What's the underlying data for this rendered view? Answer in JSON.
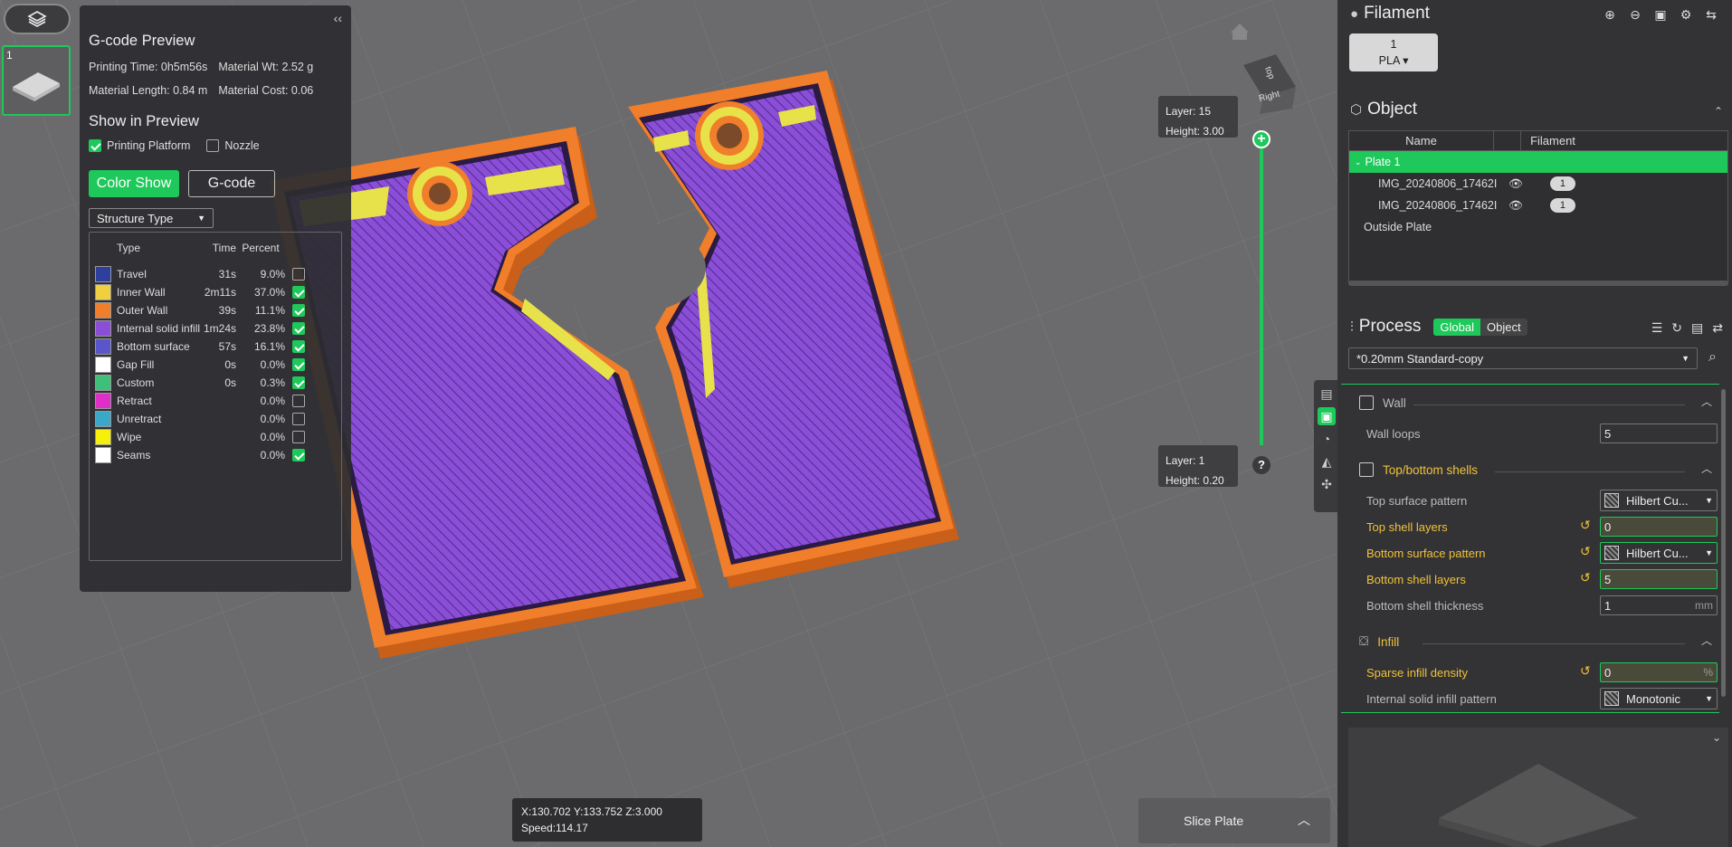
{
  "viewport": {
    "plate_thumb_number": "1",
    "nav_cube": {
      "top": "top",
      "right": "Right"
    },
    "layer_top": {
      "layer": "Layer: 15",
      "height": "Height: 3.00"
    },
    "layer_bottom": {
      "layer": "Layer: 1",
      "height": "Height: 0.20"
    },
    "slider_add": "+",
    "slider_help": "?",
    "coords": {
      "pos": "X:130.702  Y:133.752  Z:3.000",
      "speed": "Speed:114.17"
    },
    "slice_button": "Slice Plate",
    "colors": {
      "purple": "#8a4fd6",
      "orange": "#f07e2a",
      "yellow": "#e8e24a",
      "accent": "#1ec85a"
    }
  },
  "gcode_panel": {
    "collapse": "‹‹",
    "title": "G-code Preview",
    "printing_time": "Printing Time: 0h5m56s",
    "material_wt": "Material Wt: 2.52 g",
    "material_length": "Material Length: 0.84 m",
    "material_cost": "Material Cost: 0.06",
    "show_title": "Show in Preview",
    "printing_platform": "Printing Platform",
    "nozzle": "Nozzle",
    "color_show": "Color Show",
    "gcode": "G-code",
    "structure_type": "Structure Type",
    "legend_headers": {
      "type": "Type",
      "time": "Time",
      "percent": "Percent"
    },
    "legend": [
      {
        "type": "Travel",
        "time": "31s",
        "percent": "9.0%",
        "color": "#2e3f9e",
        "checked": false
      },
      {
        "type": "Inner Wall",
        "time": "2m11s",
        "percent": "37.0%",
        "color": "#f0d040",
        "checked": true
      },
      {
        "type": "Outer Wall",
        "time": "39s",
        "percent": "11.1%",
        "color": "#f07e2a",
        "checked": true
      },
      {
        "type": "Internal solid infill",
        "time": "1m24s",
        "percent": "23.8%",
        "color": "#8a4fd6",
        "checked": true
      },
      {
        "type": "Bottom surface",
        "time": "57s",
        "percent": "16.1%",
        "color": "#5a55c8",
        "checked": true
      },
      {
        "type": "Gap Fill",
        "time": "0s",
        "percent": "0.0%",
        "color": "#ffffff",
        "checked": true
      },
      {
        "type": "Custom",
        "time": "0s",
        "percent": "0.3%",
        "color": "#3ec07a",
        "checked": true
      },
      {
        "type": "Retract",
        "time": "",
        "percent": "0.0%",
        "color": "#e02ec8",
        "checked": false
      },
      {
        "type": "Unretract",
        "time": "",
        "percent": "0.0%",
        "color": "#3aa8c8",
        "checked": false
      },
      {
        "type": "Wipe",
        "time": "",
        "percent": "0.0%",
        "color": "#f6f00a",
        "checked": false
      },
      {
        "type": "Seams",
        "time": "",
        "percent": "0.0%",
        "color": "#ffffff",
        "checked": true
      }
    ]
  },
  "sidebar": {
    "filament_title": "Filament",
    "filament_pill": {
      "num": "1",
      "label": "PLA ▾"
    },
    "object_title": "Object",
    "object_headers": {
      "name": "Name",
      "filament": "Filament"
    },
    "objects": [
      {
        "name": "Plate 1",
        "selected": true
      },
      {
        "name": "IMG_20240806_17462I",
        "filament": "1"
      },
      {
        "name": "IMG_20240806_17462I",
        "filament": "1"
      },
      {
        "name": "Outside Plate"
      }
    ],
    "process_title": "Process",
    "global": "Global",
    "object_tab": "Object",
    "preset": "*0.20mm Standard-copy",
    "groups": {
      "wall": "Wall",
      "shells": "Top/bottom shells",
      "infill": "Infill"
    },
    "params": {
      "wall_loops": {
        "label": "Wall loops",
        "value": "5"
      },
      "top_surface_pattern": {
        "label": "Top surface pattern",
        "value": "Hilbert Cu..."
      },
      "top_shell_layers": {
        "label": "Top shell layers",
        "value": "0"
      },
      "bottom_surface_pattern": {
        "label": "Bottom surface pattern",
        "value": "Hilbert Cu..."
      },
      "bottom_shell_layers": {
        "label": "Bottom shell layers",
        "value": "5"
      },
      "bottom_shell_thickness": {
        "label": "Bottom shell thickness",
        "value": "1",
        "unit": "mm"
      },
      "sparse_infill_density": {
        "label": "Sparse infill density",
        "value": "0",
        "unit": "%"
      },
      "internal_solid_infill_pattern": {
        "label": "Internal solid infill pattern",
        "value": "Monotonic"
      }
    }
  }
}
